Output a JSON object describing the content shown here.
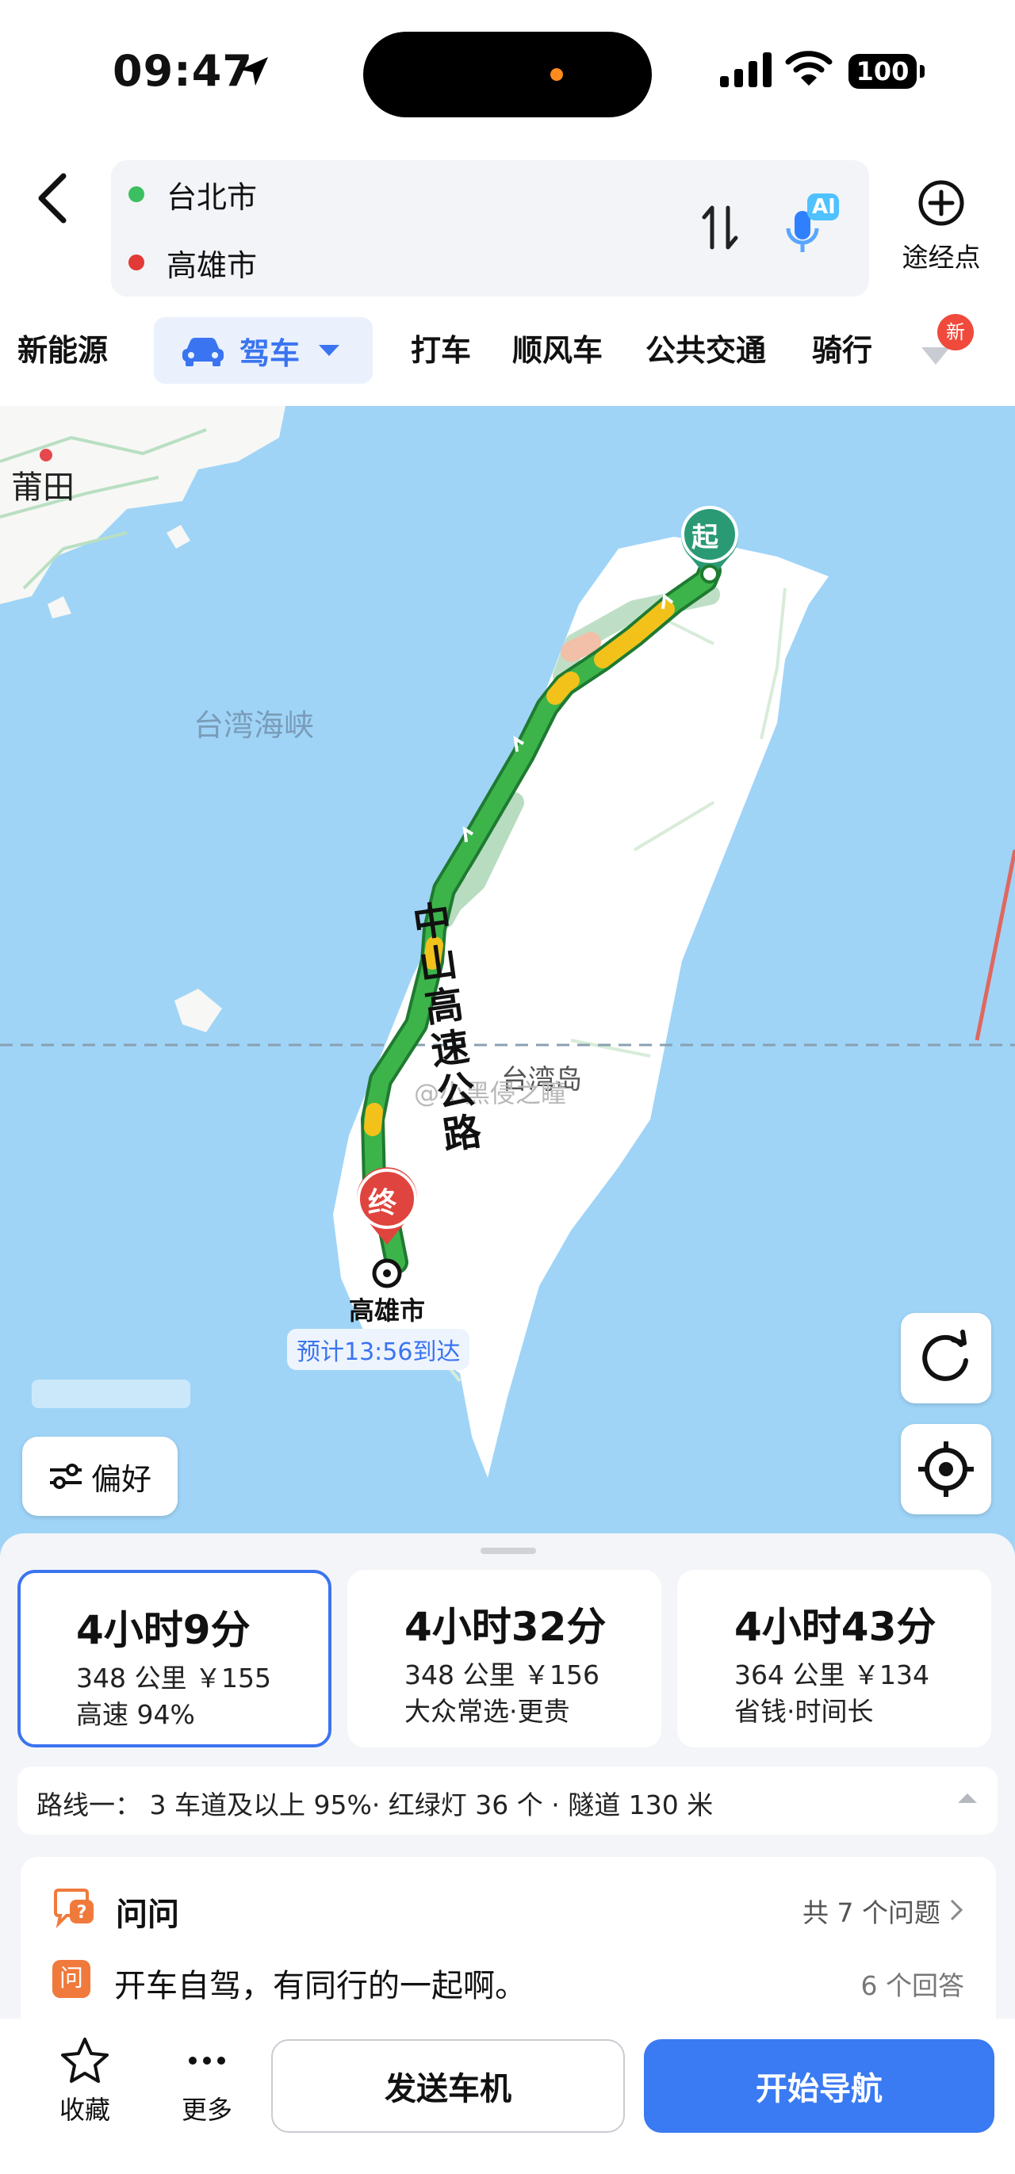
{
  "status_bar": {
    "time": "09:47",
    "battery": "100"
  },
  "header": {
    "origin": "台北市",
    "destination": "高雄市",
    "origin_dot_color": "#3cbf60",
    "destination_dot_color": "#e23a36",
    "ai_badge": "AI",
    "waypoint_label": "途经点"
  },
  "tabs": {
    "items": [
      "新能源",
      "驾车",
      "打车",
      "顺风车",
      "公共交通",
      "骑行"
    ],
    "active": "驾车",
    "new_badge": "新"
  },
  "map": {
    "labels": {
      "putian": "莆田",
      "strait": "台湾海峡",
      "island": "台湾岛",
      "highway": "中山高速公路",
      "start_marker": "起",
      "end_marker": "终",
      "destination_name": "高雄市",
      "eta": "预计13:56到达",
      "watermark": "@小黑侵之瞳"
    },
    "preference_button": "偏好",
    "route_color": "#3cb44a",
    "congestion_color": "#f2c21b"
  },
  "routes": [
    {
      "duration": "4小时9分",
      "distance_cost": "348 公里 ￥155",
      "note": "高速 94%",
      "selected": true
    },
    {
      "duration": "4小时32分",
      "distance_cost": "348 公里 ￥156",
      "note": "大众常选·更贵",
      "selected": false
    },
    {
      "duration": "4小时43分",
      "distance_cost": "364 公里 ￥134",
      "note": "省钱·时间长",
      "selected": false
    }
  ],
  "route_detail": "路线一： 3 车道及以上 95%· 红绿灯 36 个 · 隧道 130 米",
  "qa": {
    "title": "问问",
    "count": "共 7 个问题",
    "question_icon": "问",
    "question": "开车自驾，有同行的一起啊。",
    "answers": "6 个回答"
  },
  "bottom_bar": {
    "favorite": "收藏",
    "more": "更多",
    "send_to_car": "发送车机",
    "start_nav": "开始导航",
    "accent": "#3a7af2"
  }
}
